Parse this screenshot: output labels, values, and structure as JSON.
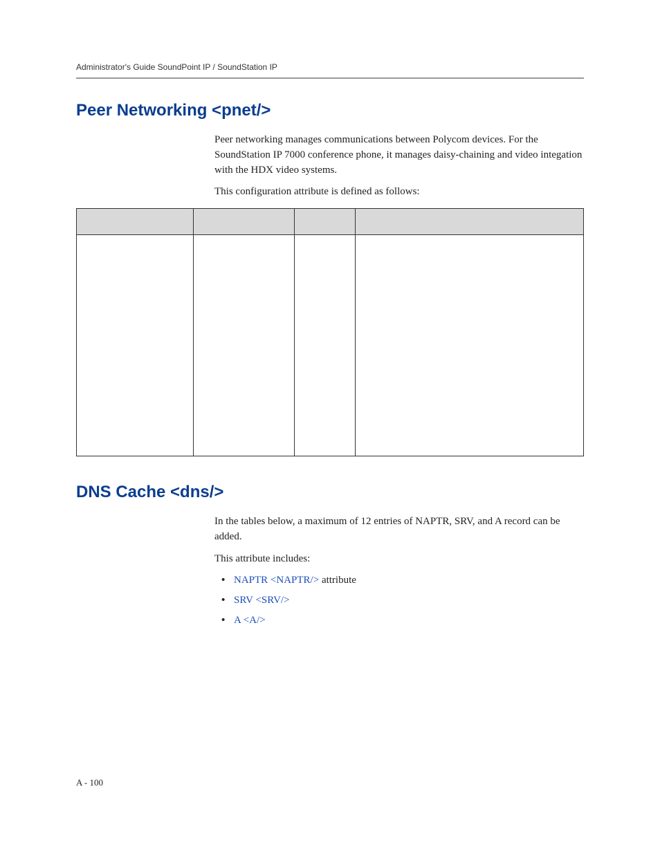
{
  "header": {
    "running": "Administrator's Guide SoundPoint IP / SoundStation IP"
  },
  "section1": {
    "heading": "Peer Networking <pnet/>",
    "para1": "Peer networking manages communications between Polycom devices. For the SoundStation IP 7000 conference phone, it manages daisy-chaining and video integation with the HDX video systems.",
    "para2": "This configuration attribute is defined as follows:"
  },
  "section2": {
    "heading": "DNS Cache <dns/>",
    "para1": "In the tables below, a maximum of 12 entries of NAPTR, SRV, and A record can be added.",
    "para2": "This attribute includes:",
    "bullets": {
      "b1_link": "NAPTR <NAPTR/>",
      "b1_tail": " attribute",
      "b2_link": "SRV <SRV/>",
      "b3_link": "A <A/>"
    }
  },
  "footer": {
    "pageNumber": "A - 100"
  }
}
